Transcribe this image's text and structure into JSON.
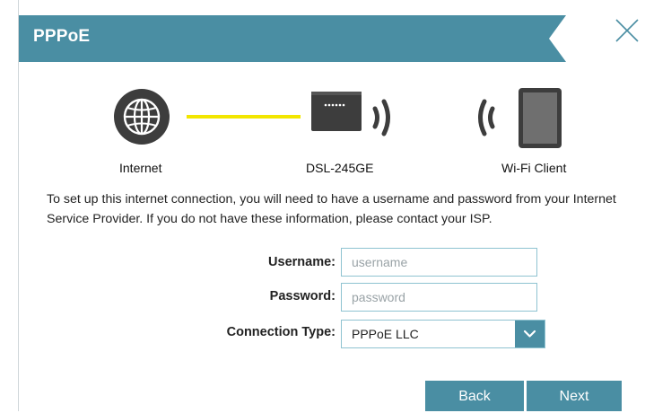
{
  "header": {
    "title": "PPPoE"
  },
  "devices": {
    "internet": "Internet",
    "modem": "DSL-245GE",
    "client": "Wi-Fi Client"
  },
  "instructions": "To set up this internet connection, you will need to have a username and password from your Internet Service Provider. If you do not have these information, please contact your ISP.",
  "form": {
    "username_label": "Username:",
    "username_placeholder": "username",
    "username_value": "",
    "password_label": "Password:",
    "password_placeholder": "password",
    "password_value": "",
    "connection_type_label": "Connection Type:",
    "connection_type_value": "PPPoE LLC"
  },
  "buttons": {
    "back": "Back",
    "next": "Next"
  },
  "colors": {
    "accent": "#4a8ea3",
    "link_line": "#f2e600",
    "device_dark": "#3d3d3d",
    "field_border": "#8fc3d1"
  },
  "icons": [
    "close-icon",
    "globe-icon",
    "router-icon",
    "wifi-signal-icon",
    "tablet-icon",
    "chevron-down-icon"
  ]
}
